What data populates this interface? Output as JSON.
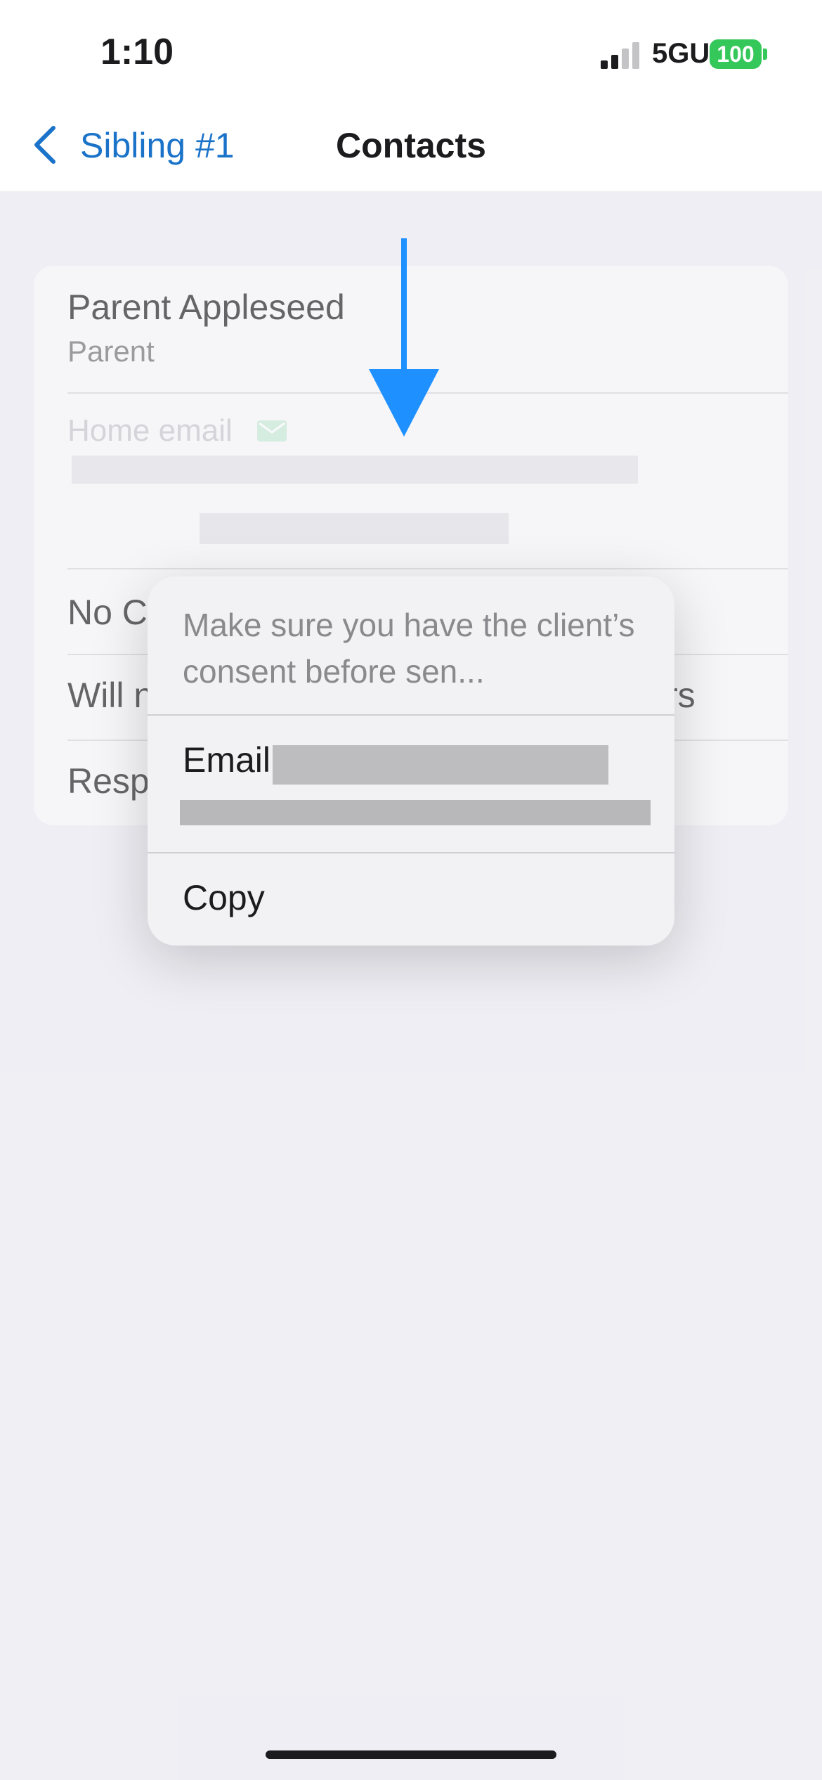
{
  "status_bar": {
    "time": "1:10",
    "network": "5GUC",
    "battery": "100"
  },
  "nav": {
    "back_label": "Sibling #1",
    "title": "Contacts"
  },
  "contact": {
    "name": "Parent Appleseed",
    "role": "Parent",
    "home_email_label": "Home email"
  },
  "rows": [
    {
      "text": "No C"
    },
    {
      "text": "Will n",
      "tail": "rs"
    },
    {
      "text": "Resp"
    }
  ],
  "menu": {
    "hint": "Make sure you have the client’s consent before sen...",
    "email_label": "Email",
    "copy_label": "Copy"
  },
  "colors": {
    "accent": "#1a73c9",
    "battery": "#34C759",
    "arrow": "#1E90FF"
  }
}
